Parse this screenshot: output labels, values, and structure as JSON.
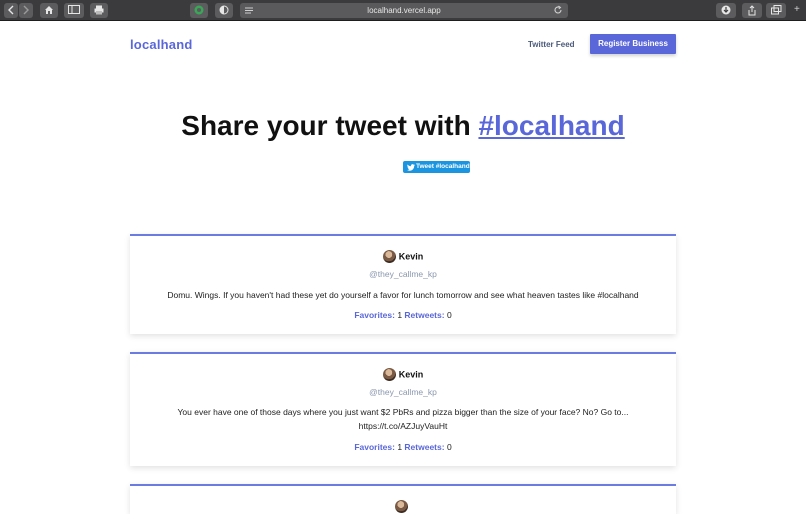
{
  "browser": {
    "url": "localhand.vercel.app"
  },
  "header": {
    "logo": "localhand",
    "nav_feed": "Twitter Feed",
    "register_label": "Register Business"
  },
  "hero": {
    "title_prefix": "Share your tweet with ",
    "hashtag": "#localhand",
    "tweet_button_label": "Tweet #localhand"
  },
  "tweets": [
    {
      "name": "Kevin",
      "handle": "@they_callme_kp",
      "text_line1": "Domu. Wings. If you haven't had these yet do yourself a favor for lunch tomorrow and see what heaven tastes like #localhand",
      "text_line2": "",
      "favorites_label": "Favorites:",
      "favorites": "1",
      "retweets_label": "Retweets:",
      "retweets": "0"
    },
    {
      "name": "Kevin",
      "handle": "@they_callme_kp",
      "text_line1": "You ever have one of those days where you just want $2 PbRs and pizza bigger than the size of your face? No? Go to...",
      "text_line2": "https://t.co/AZJuyVauHt",
      "favorites_label": "Favorites:",
      "favorites": "1",
      "retweets_label": "Retweets:",
      "retweets": "0"
    }
  ],
  "colors": {
    "brand": "#5a67d8",
    "twitter": "#1b95e0"
  }
}
